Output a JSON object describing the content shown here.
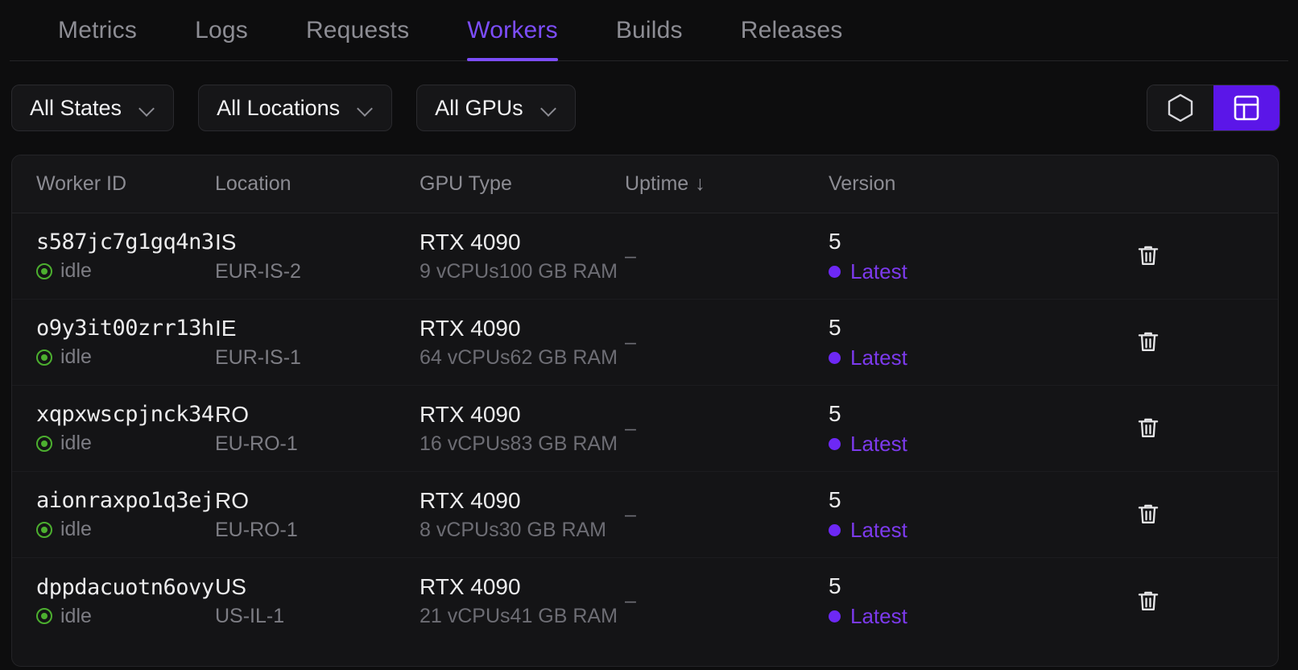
{
  "tabs": [
    {
      "label": "Metrics",
      "active": false
    },
    {
      "label": "Logs",
      "active": false
    },
    {
      "label": "Requests",
      "active": false
    },
    {
      "label": "Workers",
      "active": true
    },
    {
      "label": "Builds",
      "active": false
    },
    {
      "label": "Releases",
      "active": false
    }
  ],
  "filters": [
    {
      "label": "All States",
      "name": "state-filter"
    },
    {
      "label": "All Locations",
      "name": "location-filter"
    },
    {
      "label": "All GPUs",
      "name": "gpu-filter"
    }
  ],
  "view_toggle": {
    "card_view": {
      "icon": "hexagon-icon",
      "active": false
    },
    "table_view": {
      "icon": "table-icon",
      "active": true
    },
    "accent": "#5b16e8"
  },
  "table": {
    "columns": [
      "Worker ID",
      "Location",
      "GPU Type",
      "Uptime",
      "Version"
    ],
    "sort": {
      "column": "Uptime",
      "direction": "↓"
    },
    "rows": [
      {
        "worker_id": "s587jc7g1gq4n3",
        "state": "idle",
        "country": "IS",
        "region": "EUR-IS-2",
        "gpu": "RTX 4090",
        "specs": "9 vCPUs100 GB RAM",
        "uptime": "–",
        "version": "5",
        "version_tag": "Latest",
        "delete_icon": "trash-icon"
      },
      {
        "worker_id": "o9y3it00zrr13h",
        "state": "idle",
        "country": "IE",
        "region": "EUR-IS-1",
        "gpu": "RTX 4090",
        "specs": "64 vCPUs62 GB RAM",
        "uptime": "–",
        "version": "5",
        "version_tag": "Latest",
        "delete_icon": "trash-icon"
      },
      {
        "worker_id": "xqpxwscpjnck34",
        "state": "idle",
        "country": "RO",
        "region": "EU-RO-1",
        "gpu": "RTX 4090",
        "specs": "16 vCPUs83 GB RAM",
        "uptime": "–",
        "version": "5",
        "version_tag": "Latest",
        "delete_icon": "trash-icon"
      },
      {
        "worker_id": "aionraxpo1q3ej",
        "state": "idle",
        "country": "RO",
        "region": "EU-RO-1",
        "gpu": "RTX 4090",
        "specs": "8 vCPUs30 GB RAM",
        "uptime": "–",
        "version": "5",
        "version_tag": "Latest",
        "delete_icon": "trash-icon"
      },
      {
        "worker_id": "dppdacuotn6ovy",
        "state": "idle",
        "country": "US",
        "region": "US-IL-1",
        "gpu": "RTX 4090",
        "specs": "21 vCPUs41 GB RAM",
        "uptime": "–",
        "version": "5",
        "version_tag": "Latest",
        "delete_icon": "trash-icon"
      }
    ]
  },
  "colors": {
    "accent_purple": "#5b16e8",
    "tab_active": "#7c4dfa",
    "status_idle": "#4caf2f",
    "version_latest": "#7c3aed",
    "background": "#0d0d0e"
  }
}
